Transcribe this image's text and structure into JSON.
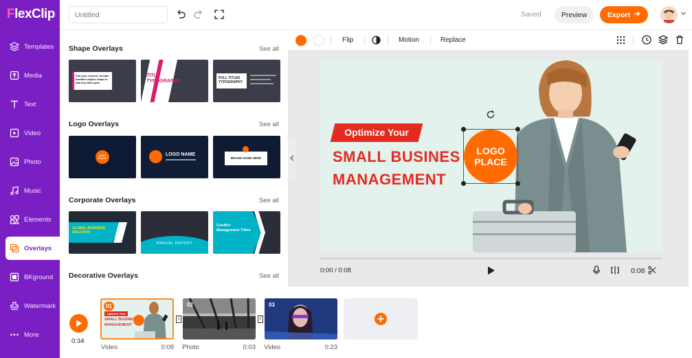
{
  "app": {
    "logo_prefix": "F",
    "logo_rest": "lexClip"
  },
  "sidebar": {
    "items": [
      {
        "label": "Templates",
        "icon": "layers-icon"
      },
      {
        "label": "Media",
        "icon": "upload-icon"
      },
      {
        "label": "Text",
        "icon": "text-icon"
      },
      {
        "label": "Video",
        "icon": "video-icon"
      },
      {
        "label": "Photo",
        "icon": "photo-icon"
      },
      {
        "label": "Music",
        "icon": "music-icon"
      },
      {
        "label": "Elements",
        "icon": "elements-icon"
      },
      {
        "label": "Overlays",
        "icon": "overlays-icon"
      },
      {
        "label": "BKground",
        "icon": "background-icon"
      },
      {
        "label": "Watermark",
        "icon": "watermark-icon"
      },
      {
        "label": "More",
        "icon": "more-icon"
      }
    ],
    "active": "Overlays"
  },
  "topbar": {
    "title_placeholder": "Untitled",
    "saved": "Saved",
    "preview": "Preview",
    "export": "Export"
  },
  "panel": {
    "see_all": "See all",
    "sections": [
      {
        "title": "Shape Overlays",
        "thumbs": [
          "Full your content, flexible duration adjust, adapt to add any titles park",
          "TITLE TYPOGRAPHY",
          "FULL TITLES TYPOGRAPHY"
        ]
      },
      {
        "title": "Logo Overlays",
        "thumbs": [
          "LOGO PLACE",
          "LOGO NAME",
          "BRAND NAME HERE"
        ]
      },
      {
        "title": "Corporate Overlays",
        "thumbs": [
          "GLOBAL BUSINESS SOLUTION",
          "ANNUAL REPORT",
          "Conflict Management Titles"
        ]
      },
      {
        "title": "Decorative Overlays",
        "thumbs": []
      }
    ]
  },
  "editor": {
    "toolbar": {
      "flip": "Flip",
      "motion": "Motion",
      "replace": "Replace"
    },
    "canvas": {
      "badge": "Optimize Your",
      "line1": "SMALL BUSINES",
      "line2": "MANAGEMENT",
      "logo_line1": "LOGO",
      "logo_line2": "PLACE"
    },
    "playback": {
      "current": "0:00 / 0:08",
      "duration": "0:08"
    }
  },
  "timeline": {
    "total": "0:34",
    "clips": [
      {
        "num": "01",
        "type": "Video",
        "duration": "0:08",
        "thumb_badge": "Optimize Your",
        "thumb_line1": "SMALL BUSINES",
        "thumb_line2": "MANAGEMENT"
      },
      {
        "num": "02",
        "type": "Photo",
        "duration": "0:03"
      },
      {
        "num": "03",
        "type": "Video",
        "duration": "0:23"
      }
    ]
  },
  "colors": {
    "sidebar": "#7a1fc4",
    "accent": "#ff6b00",
    "headline": "#e42b1f"
  }
}
